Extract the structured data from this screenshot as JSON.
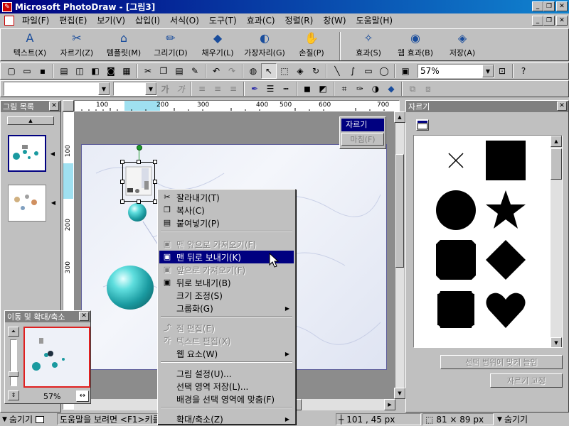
{
  "window": {
    "title": "Microsoft PhotoDraw - [그림3]",
    "app_icon_glyph": "✎",
    "minimize": "_",
    "restore": "❐",
    "close": "✕"
  },
  "menu": [
    "파일(F)",
    "편집(E)",
    "보기(V)",
    "삽입(I)",
    "서식(O)",
    "도구(T)",
    "효과(C)",
    "정렬(R)",
    "창(W)",
    "도움말(H)"
  ],
  "visual_tools": [
    {
      "label": "텍스트(X)",
      "icon": "A"
    },
    {
      "label": "자르기(Z)",
      "icon": "✂"
    },
    {
      "label": "템플릿(M)",
      "icon": "⌂"
    },
    {
      "label": "그리기(D)",
      "icon": "✏"
    },
    {
      "label": "채우기(L)",
      "icon": "◆"
    },
    {
      "label": "가장자리(G)",
      "icon": "◐"
    },
    {
      "label": "손질(P)",
      "icon": "✋"
    },
    {
      "label": "효과(S)",
      "icon": "✧"
    },
    {
      "label": "웹 효과(B)",
      "icon": "◉"
    },
    {
      "label": "저장(A)",
      "icon": "◈"
    }
  ],
  "standard_toolbar": {
    "zoom_value": "57%",
    "help_glyph": "?"
  },
  "picture_list": {
    "title": "그림 목록"
  },
  "ruler": {
    "h_ticks": [
      "100",
      "200",
      "300",
      "400",
      "500",
      "600",
      "700"
    ],
    "v_ticks": [
      "100",
      "200",
      "300"
    ]
  },
  "crop_mini": {
    "crop_label": "자르기",
    "mirror_label": "마침(F)"
  },
  "context_menu": {
    "items": [
      {
        "label": "잘라내기(T)",
        "icon": "✂",
        "state": "normal"
      },
      {
        "label": "복사(C)",
        "icon": "❐",
        "state": "normal"
      },
      {
        "label": "붙여넣기(P)",
        "icon": "▤",
        "state": "normal"
      },
      {
        "label": "맨 앞으로 가져오기(F)",
        "icon": "▣",
        "state": "disabled"
      },
      {
        "label": "맨 뒤로 보내기(K)",
        "icon": "▣",
        "state": "highlighted"
      },
      {
        "label": "앞으로 가져오기(F)",
        "icon": "▣",
        "state": "disabled"
      },
      {
        "label": "뒤로 보내기(B)",
        "icon": "▣",
        "state": "normal"
      },
      {
        "label": "크기 조정(S)",
        "icon": "",
        "state": "normal"
      },
      {
        "label": "그룹화(G)",
        "icon": "",
        "state": "normal",
        "submenu": true
      },
      {
        "label": "점 편집(E)",
        "icon": "⤴",
        "state": "disabled"
      },
      {
        "label": "텍스트 편집(X)",
        "icon": "가",
        "state": "disabled"
      },
      {
        "label": "웹 요소(W)",
        "icon": "",
        "state": "normal",
        "submenu": true
      },
      {
        "label": "그림 설정(U)...",
        "icon": "",
        "state": "normal"
      },
      {
        "label": "선택 영역 저장(L)...",
        "icon": "",
        "state": "normal"
      },
      {
        "label": "배경을 선택 영역에 맞춤(F)",
        "icon": "",
        "state": "normal"
      },
      {
        "label": "확대/축소(Z)",
        "icon": "",
        "state": "normal",
        "submenu": true
      }
    ]
  },
  "pan_zoom": {
    "title": "이동 및 확대/축소",
    "zoom_percent": "57%"
  },
  "crop_pane": {
    "title": "자르기",
    "fit_button": "선택 범위에 맞게 늘임",
    "fix_button": "자르기 고정",
    "shapes": [
      "x-mark",
      "square",
      "circle",
      "star",
      "octagon",
      "diamond",
      "stamp",
      "heart"
    ]
  },
  "status": {
    "hide_label": "숨기기",
    "help_text": "도움말을 보려면 <F1>키를",
    "position": "101 , 45  px",
    "size": "81 × 89  px",
    "hide_label_right": "숨기기"
  },
  "colors": {
    "title_gradient_start": "#000080",
    "title_gradient_end": "#1084d0",
    "highlight": "#000080",
    "sphere": "#1a9aa0",
    "pan_zoom_frame": "#e02020",
    "rotate_handle": "#1c9b2c"
  }
}
